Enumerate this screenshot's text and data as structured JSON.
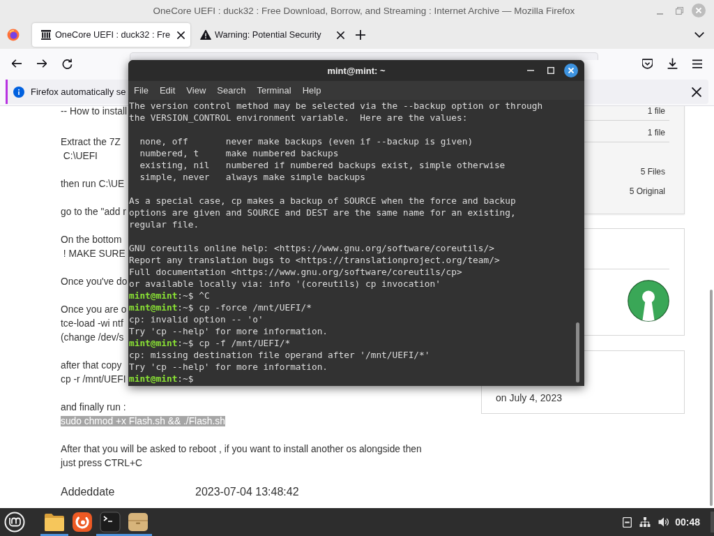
{
  "browser": {
    "window_title": "OneCore UEFI : duck32 : Free Download, Borrow, and Streaming : Internet Archive — Mozilla Firefox",
    "tabs": [
      {
        "kind": "archive",
        "title": "OneCore UEFI : duck32 : Fre",
        "selected": true
      },
      {
        "kind": "warning",
        "title": "Warning: Potential Security",
        "selected": false
      }
    ],
    "notification": {
      "text": "Firefox automatically se"
    },
    "page": {
      "paragraphs": [
        {
          "lines": [
            {
              "text": "-- How to install",
              "highlighted": false
            }
          ]
        },
        {
          "lines": [
            {
              "text": "Extract the 7Z",
              "highlighted": false
            },
            {
              "text": " C:\\UEFI",
              "highlighted": false
            }
          ]
        },
        {
          "lines": [
            {
              "text": "then run C:\\UE",
              "highlighted": false
            }
          ]
        },
        {
          "lines": [
            {
              "text": "go to the \"add r",
              "highlighted": false
            }
          ]
        },
        {
          "lines": [
            {
              "text": "On the bottom",
              "highlighted": false
            },
            {
              "text": " ! MAKE SURE",
              "highlighted": false
            }
          ]
        },
        {
          "lines": [
            {
              "text": "Once you've do",
              "highlighted": false
            }
          ]
        },
        {
          "lines": [
            {
              "text": "Once you are o",
              "highlighted": false
            },
            {
              "text": "tce-load -wi ntf",
              "highlighted": false
            },
            {
              "text": "(change /dev/s",
              "highlighted": false
            }
          ]
        },
        {
          "lines": [
            {
              "text": "after that copy",
              "highlighted": false
            },
            {
              "text": "cp -r /mnt/UEFI",
              "highlighted": false
            }
          ]
        },
        {
          "lines": [
            {
              "text": "and finally run :",
              "highlighted": false
            },
            {
              "text": "sudo chmod +x Flash.sh && ./Flash.sh",
              "highlighted": true
            }
          ]
        },
        {
          "lines": [
            {
              "text": "After that you will be asked to reboot , if you want to install another os alongside then",
              "highlighted": false
            },
            {
              "text": "just press CTRL+C",
              "highlighted": false
            }
          ]
        }
      ],
      "metadata": [
        {
          "label": "Addeddate",
          "value": "2023-07-04 13:48:42"
        }
      ],
      "file_rows": [
        "1 file",
        "1 file"
      ],
      "totals": [
        "5 Files",
        "5 Original"
      ],
      "uploader_card": {
        "date": "on July 4, 2023"
      }
    }
  },
  "terminal": {
    "title": "mint@mint: ~",
    "menu": [
      "File",
      "Edit",
      "View",
      "Search",
      "Terminal",
      "Help"
    ],
    "lines": [
      {
        "kind": "output",
        "text": "The version control method may be selected via the --backup option or through"
      },
      {
        "kind": "output",
        "text": "the VERSION_CONTROL environment variable.  Here are the values:"
      },
      {
        "kind": "blank"
      },
      {
        "kind": "output",
        "text": "  none, off       never make backups (even if --backup is given)"
      },
      {
        "kind": "output",
        "text": "  numbered, t     make numbered backups"
      },
      {
        "kind": "output",
        "text": "  existing, nil   numbered if numbered backups exist, simple otherwise"
      },
      {
        "kind": "output",
        "text": "  simple, never   always make simple backups"
      },
      {
        "kind": "blank"
      },
      {
        "kind": "output",
        "text": "As a special case, cp makes a backup of SOURCE when the force and backup"
      },
      {
        "kind": "output",
        "text": "options are given and SOURCE and DEST are the same name for an existing,"
      },
      {
        "kind": "output",
        "text": "regular file."
      },
      {
        "kind": "blank"
      },
      {
        "kind": "output",
        "text": "GNU coreutils online help: <https://www.gnu.org/software/coreutils/>"
      },
      {
        "kind": "output",
        "text": "Report any translation bugs to <https://translationproject.org/team/>"
      },
      {
        "kind": "output",
        "text": "Full documentation <https://www.gnu.org/software/coreutils/cp>"
      },
      {
        "kind": "output",
        "text": "or available locally via: info '(coreutils) cp invocation'"
      },
      {
        "kind": "prompt",
        "user": "mint@mint",
        "path": ":~$",
        "command": "^C"
      },
      {
        "kind": "prompt",
        "user": "mint@mint",
        "path": ":~$",
        "command": "cp -force /mnt/UEFI/*"
      },
      {
        "kind": "output",
        "text": "cp: invalid option -- 'o'"
      },
      {
        "kind": "output",
        "text": "Try 'cp --help' for more information."
      },
      {
        "kind": "prompt",
        "user": "mint@mint",
        "path": ":~$",
        "command": "cp -f /mnt/UEFI/*"
      },
      {
        "kind": "output",
        "text": "cp: missing destination file operand after '/mnt/UEFI/*'"
      },
      {
        "kind": "output",
        "text": "Try 'cp --help' for more information."
      },
      {
        "kind": "prompt",
        "user": "mint@mint",
        "path": ":~$"
      }
    ]
  },
  "taskbar": {
    "launchers": [
      {
        "kind": "folder",
        "running": true
      },
      {
        "kind": "browser",
        "running": false
      },
      {
        "kind": "terminal",
        "running": true
      },
      {
        "kind": "archive",
        "running": true
      }
    ],
    "clock": "00:48"
  }
}
